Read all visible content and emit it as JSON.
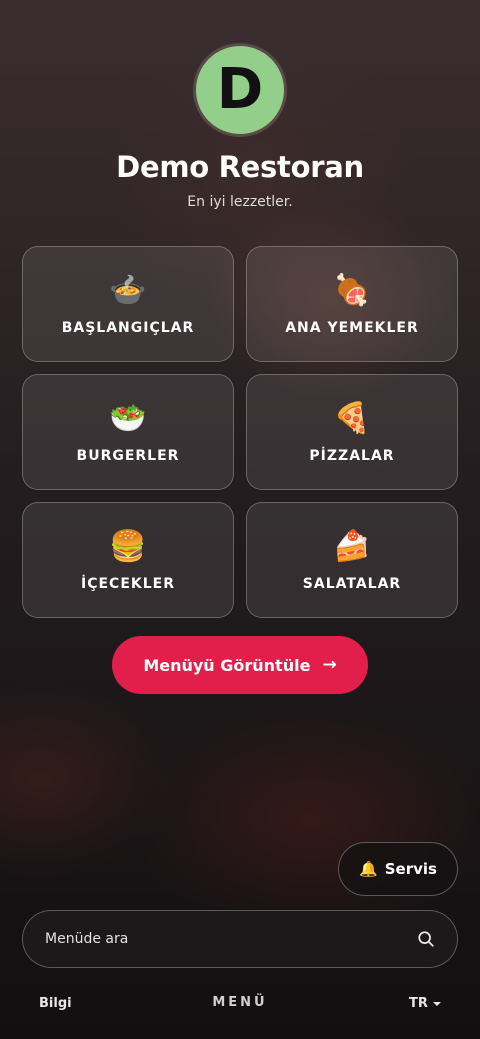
{
  "header": {
    "logo_letter": "D",
    "restaurant_name": "Demo Restoran",
    "tagline": "En iyi lezzetler."
  },
  "categories": [
    {
      "label": "BAŞLANGIÇLAR",
      "icon": "stew-pot-icon",
      "glyph": "🍲"
    },
    {
      "label": "ANA YEMEKLER",
      "icon": "meat-on-bone-icon",
      "glyph": "🍖"
    },
    {
      "label": "BURGERLER",
      "icon": "salad-bowl-icon",
      "glyph": "🥗"
    },
    {
      "label": "PİZZALAR",
      "icon": "pizza-slice-icon",
      "glyph": "🍕"
    },
    {
      "label": "İÇECEKLER",
      "icon": "hamburger-icon",
      "glyph": "🍔"
    },
    {
      "label": "SALATALAR",
      "icon": "cake-slice-icon",
      "glyph": "🍰"
    }
  ],
  "menu_button": {
    "label": "Menüyü Görüntüle",
    "arrow": "→"
  },
  "service_button": {
    "label": "Servis",
    "glyph": "🔔"
  },
  "search": {
    "placeholder": "Menüde ara"
  },
  "footer": {
    "info_label": "Bilgi",
    "menu_label": "MENÜ",
    "language": "TR"
  },
  "colors": {
    "accent": "#e21f4a",
    "logo_bg": "#93cf8a"
  }
}
